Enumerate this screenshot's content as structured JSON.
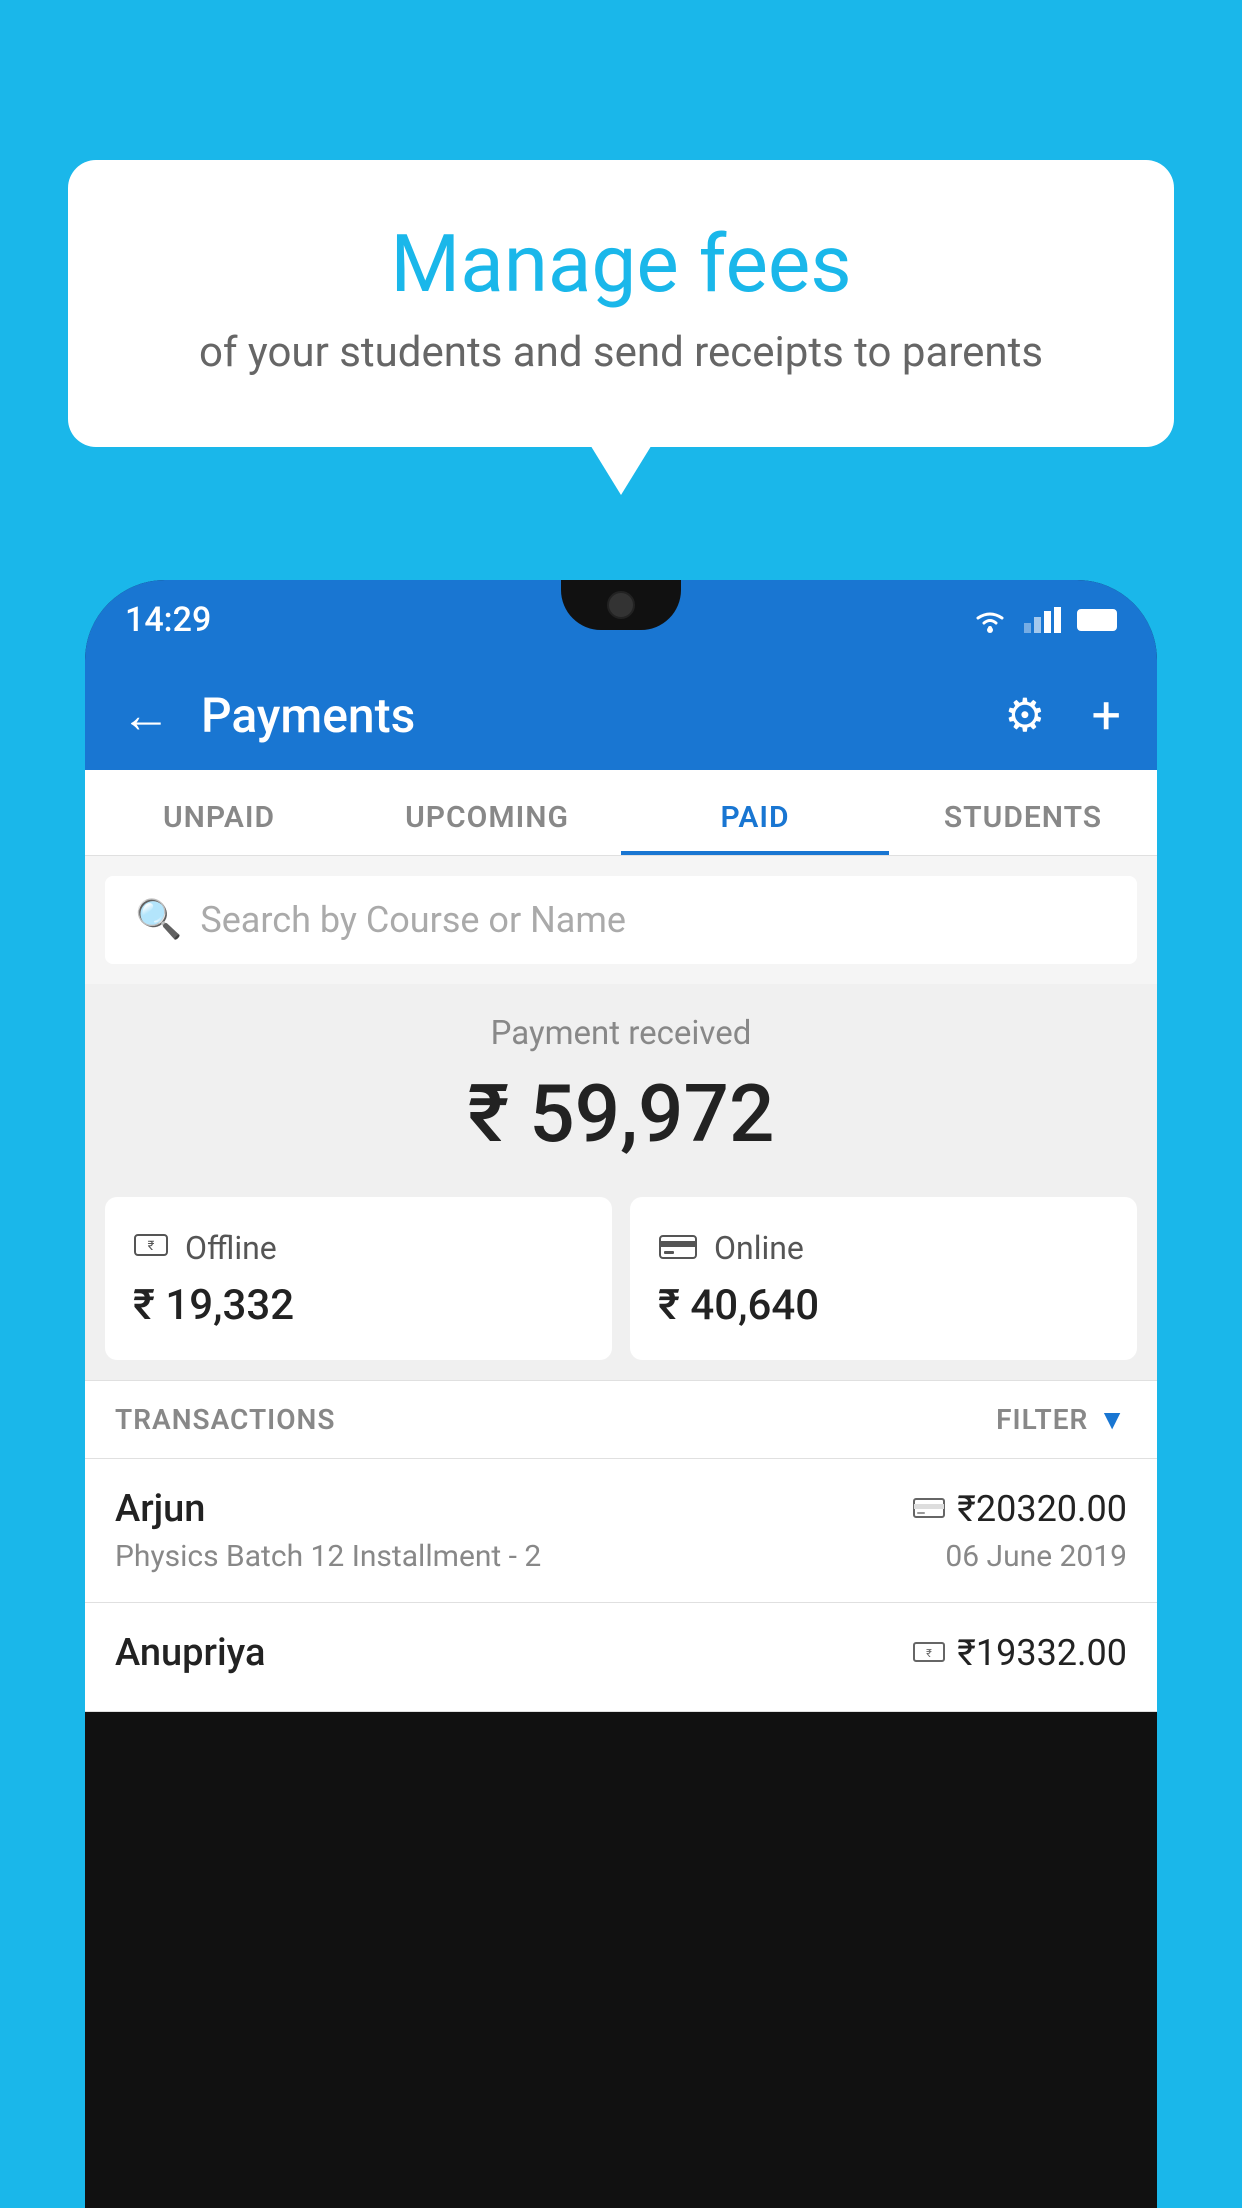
{
  "background_color": "#1ab7ea",
  "speech_bubble": {
    "title": "Manage fees",
    "subtitle": "of your students and send receipts to parents"
  },
  "status_bar": {
    "time": "14:29"
  },
  "app_bar": {
    "title": "Payments",
    "back_label": "←",
    "gear_label": "⚙",
    "plus_label": "+"
  },
  "tabs": [
    {
      "label": "UNPAID",
      "active": false
    },
    {
      "label": "UPCOMING",
      "active": false
    },
    {
      "label": "PAID",
      "active": true
    },
    {
      "label": "STUDENTS",
      "active": false
    }
  ],
  "search": {
    "placeholder": "Search by Course or Name"
  },
  "payment_received": {
    "label": "Payment received",
    "amount": "₹ 59,972"
  },
  "cards": [
    {
      "type": "Offline",
      "amount": "₹ 19,332",
      "icon": "💳"
    },
    {
      "type": "Online",
      "amount": "₹ 40,640",
      "icon": "🏦"
    }
  ],
  "transactions_label": "TRANSACTIONS",
  "filter_label": "FILTER",
  "transactions": [
    {
      "name": "Arjun",
      "amount": "₹20320.00",
      "course": "Physics Batch 12 Installment - 2",
      "date": "06 June 2019",
      "payment_type": "card"
    },
    {
      "name": "Anupriya",
      "amount": "₹19332.00",
      "course": "",
      "date": "",
      "payment_type": "offline"
    }
  ]
}
